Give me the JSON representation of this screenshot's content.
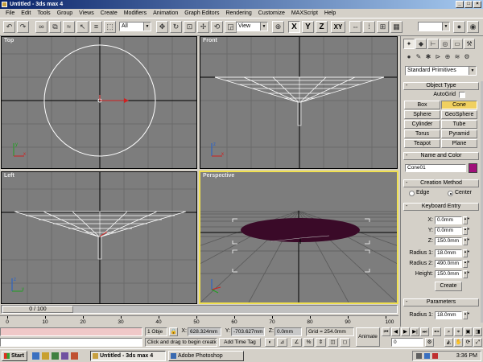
{
  "window": {
    "title": "Untitled - 3ds max 4",
    "buttons": [
      "_",
      "□",
      "×"
    ]
  },
  "menu": [
    "File",
    "Edit",
    "Tools",
    "Group",
    "Views",
    "Create",
    "Modifiers",
    "Animation",
    "Graph Editors",
    "Rendering",
    "Customize",
    "MAXScript",
    "Help"
  ],
  "toolbar": {
    "selection_filter": "All",
    "ref_coord": "View",
    "axis_x": "X",
    "axis_y": "Y",
    "axis_z": "Z",
    "axis_xy": "XY"
  },
  "viewports": {
    "top": "Top",
    "front": "Front",
    "left": "Left",
    "perspective": "Perspective"
  },
  "command_panel": {
    "category": "Standard Primitives",
    "object_type": {
      "title": "Object Type",
      "autogrid": "AutoGrid",
      "buttons": [
        "Box",
        "Cone",
        "Sphere",
        "GeoSphere",
        "Cylinder",
        "Tube",
        "Torus",
        "Pyramid",
        "Teapot",
        "Plane"
      ],
      "selected": "Cone"
    },
    "name_color": {
      "title": "Name and Color",
      "name": "Cone01",
      "color": "#a0107a"
    },
    "creation_method": {
      "title": "Creation Method",
      "edge": "Edge",
      "center": "Center",
      "selected": "Center"
    },
    "keyboard_entry": {
      "title": "Keyboard Entry",
      "x_label": "X:",
      "x": "0.0mm",
      "y_label": "Y:",
      "y": "0.0mm",
      "z_label": "Z:",
      "z": "150.0mm",
      "r1_label": "Radius 1:",
      "r1": "18.0mm",
      "r2_label": "Radius 2:",
      "r2": "490.0mm",
      "height_label": "Height:",
      "height": "150.0mm",
      "create": "Create"
    },
    "parameters": {
      "title": "Parameters",
      "r1_label": "Radius 1:",
      "r1": "18.0mm"
    },
    "tabs": [
      "create",
      "modify",
      "hierarchy",
      "motion",
      "display",
      "utilities"
    ]
  },
  "timeline": {
    "slider": "0 / 100",
    "ticks": [
      "0",
      "10",
      "20",
      "30",
      "40",
      "50",
      "60",
      "70",
      "80",
      "90",
      "100"
    ]
  },
  "status": {
    "selection": "1 Obje",
    "x_label": "X:",
    "x": "628.324mm",
    "y_label": "Y:",
    "y": "-703.627mm",
    "z_label": "Z:",
    "z": "0.0mm",
    "grid": "Grid = 254.0mm",
    "animate": "Animate",
    "prompt": "Click and drag to begin creatio",
    "add_time_tag": "Add Time Tag",
    "frame": "0"
  },
  "taskbar": {
    "start": "Start",
    "items": [
      "Untitled - 3ds max 4",
      "Adobe Photoshop"
    ],
    "clock": "3:36 PM"
  },
  "colors": {
    "viewport_bg": "#7d7d7d",
    "active_border": "#f0e050",
    "cone": "#3a0a28",
    "selected_button": "#f0d060"
  }
}
